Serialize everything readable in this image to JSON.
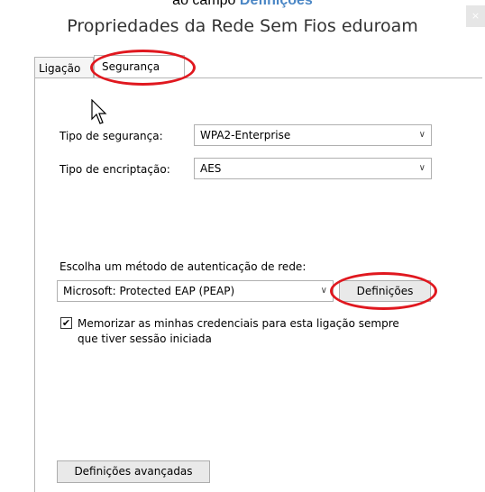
{
  "caption": {
    "prefix": "ao campo",
    "highlight": "Definições"
  },
  "window": {
    "title": "Propriedades da Rede Sem Fios eduroam",
    "close": "×"
  },
  "tabs": [
    {
      "label": "Ligação"
    },
    {
      "label": "Segurança"
    }
  ],
  "security": {
    "type_label": "Tipo de segurança:",
    "type_value": "WPA2-Enterprise",
    "encryption_label": "Tipo de encriptação:",
    "encryption_value": "AES"
  },
  "auth": {
    "label": "Escolha um método de autenticação de rede:",
    "method_value": "Microsoft: Protected EAP (PEAP)",
    "settings_button": "Definições",
    "remember_line1": "Memorizar as minhas credenciais para esta ligação sempre",
    "remember_line2": "que tiver sessão iniciada",
    "remember_checked": true
  },
  "advanced_button": "Definições avançadas",
  "colors": {
    "highlight_ring": "#e0181f",
    "caption_link": "#4a86c5"
  },
  "icons": {
    "dropdown": "chevron-down-icon",
    "check": "checkmark-icon",
    "cursor": "mouse-pointer-icon"
  }
}
